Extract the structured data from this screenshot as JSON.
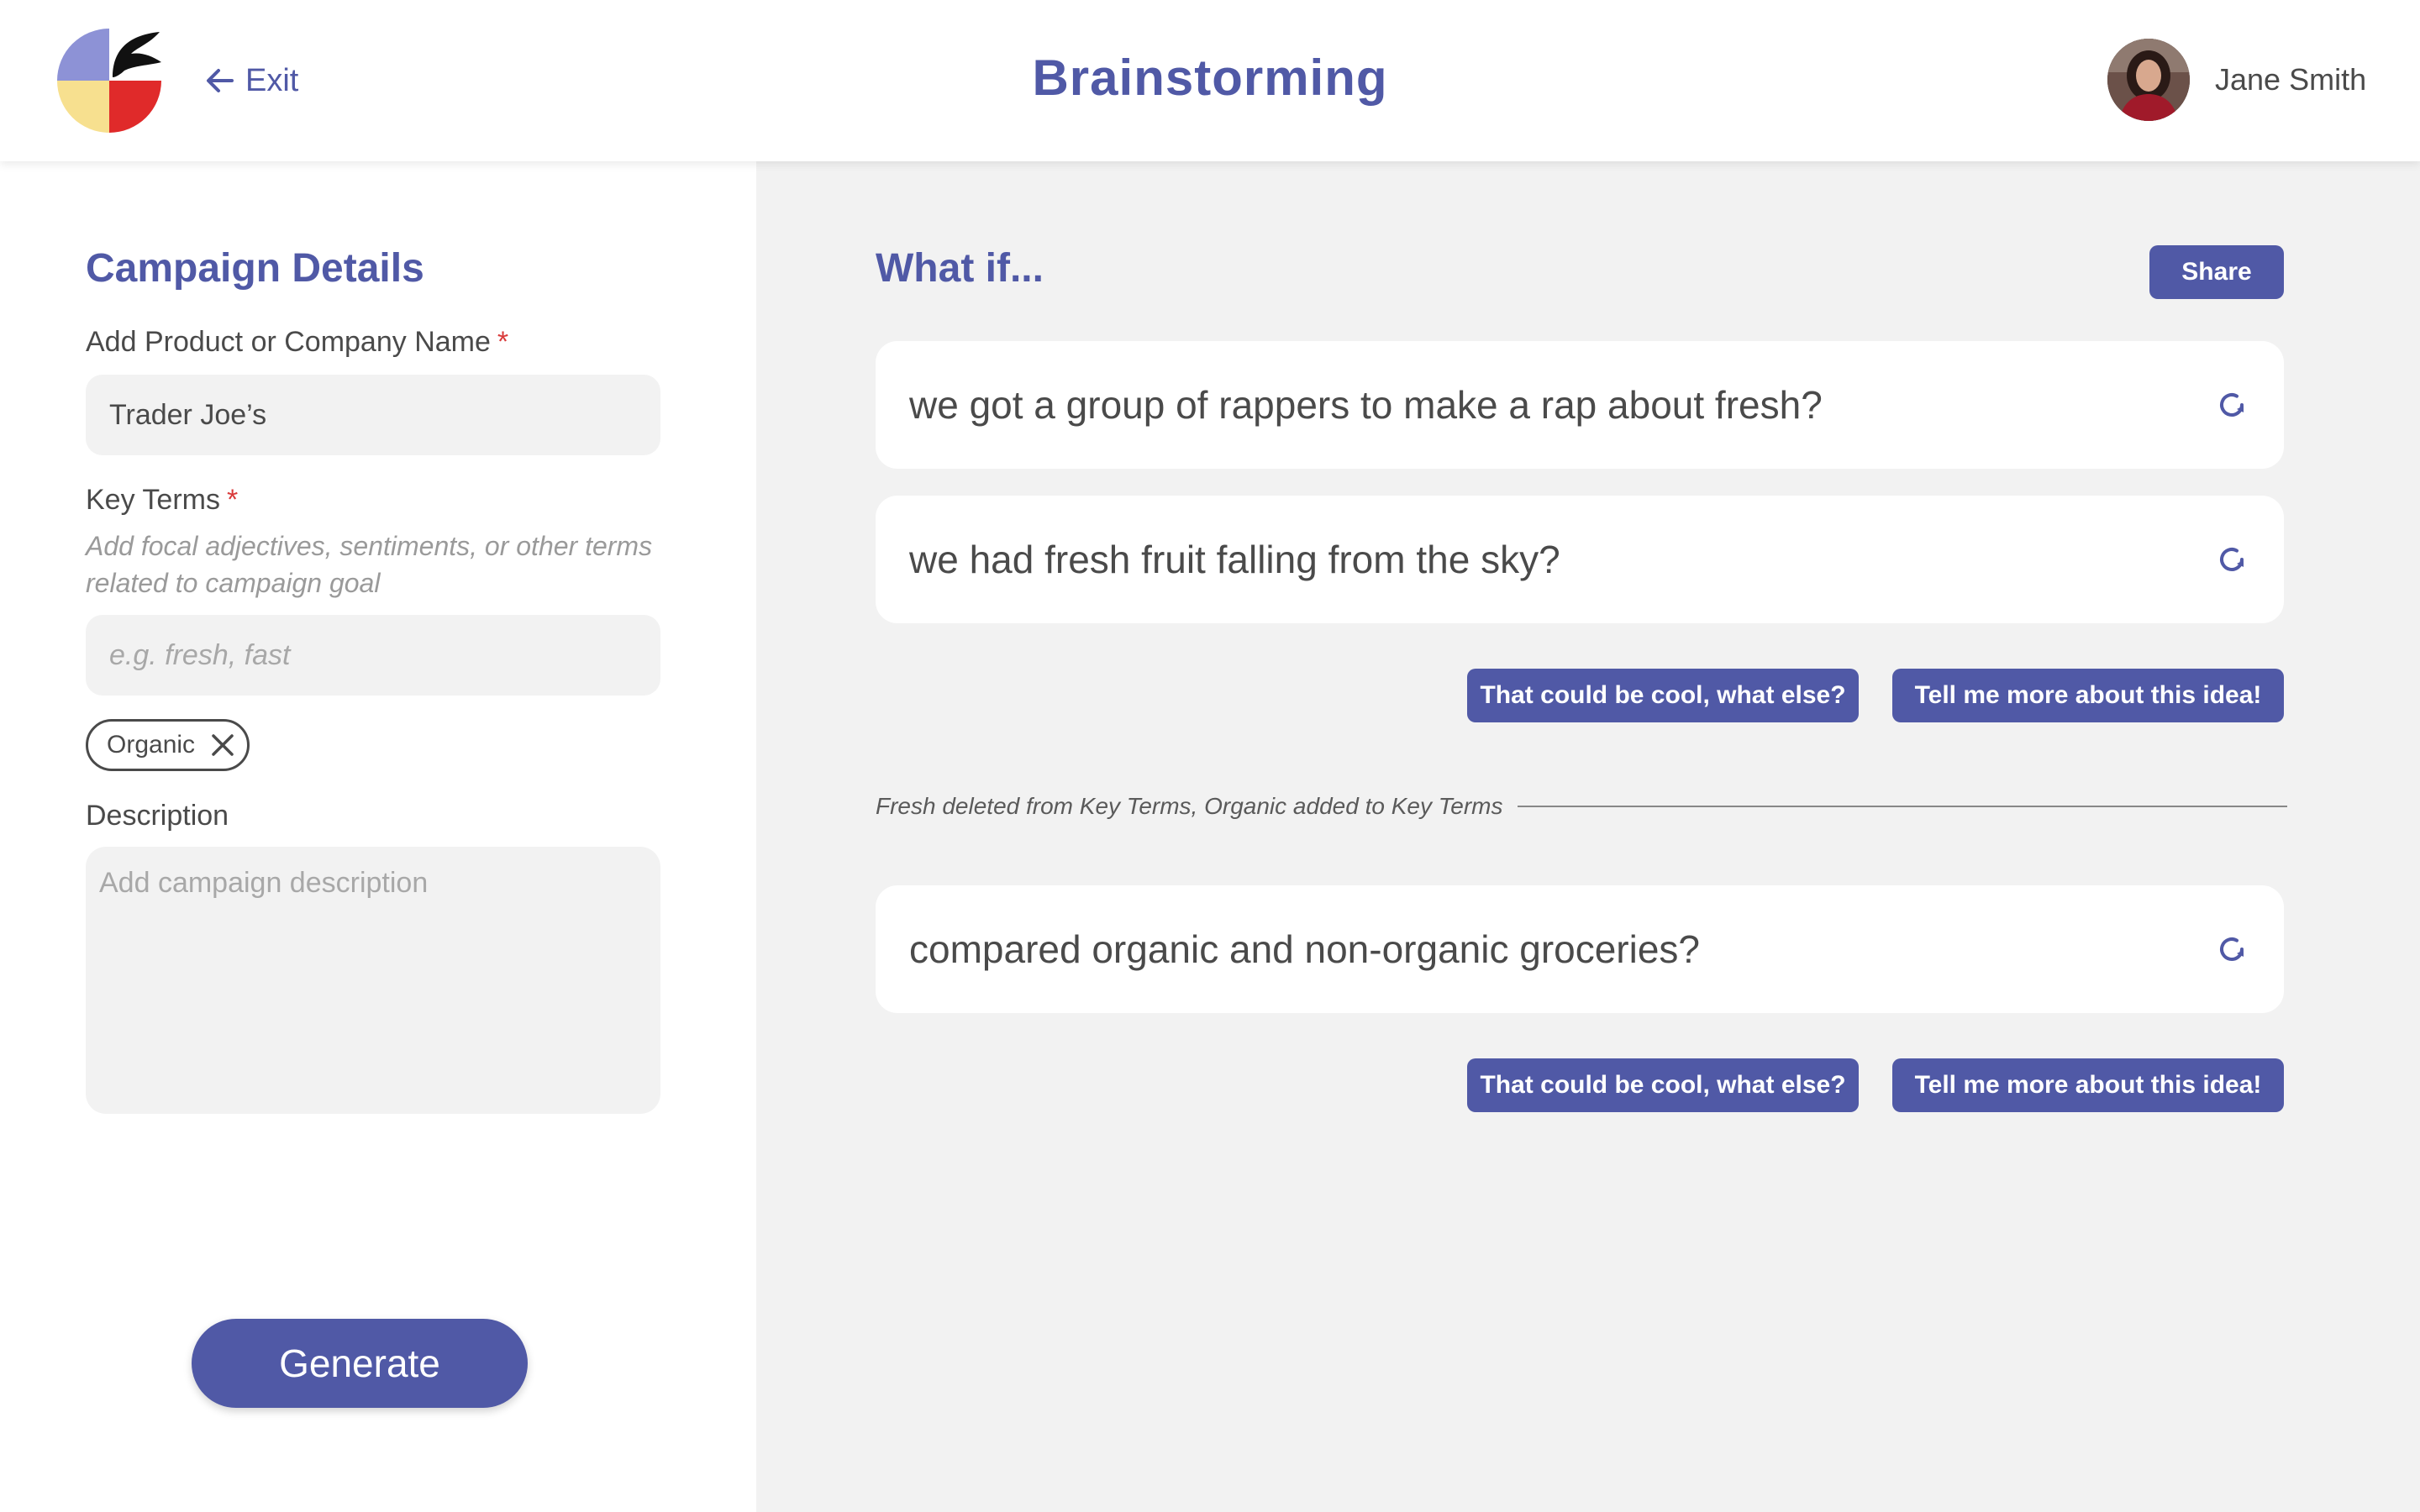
{
  "header": {
    "exit_label": "Exit",
    "title": "Brainstorming",
    "user_name": "Jane Smith"
  },
  "campaign": {
    "section_title": "Campaign Details",
    "product_label": "Add Product or Company Name",
    "product_value": "Trader Joe’s",
    "key_terms_label": "Key Terms",
    "required_mark": "*",
    "key_terms_hint": "Add focal adjectives, sentiments, or other terms related to campaign goal",
    "key_terms_placeholder": "e.g. fresh, fast",
    "chip_label": "Organic",
    "description_label": "Description",
    "description_placeholder": "Add campaign description",
    "generate_label": "Generate"
  },
  "ideas": {
    "heading": "What if...",
    "share_label": "Share",
    "cards": [
      "we got a group of rappers to make a rap about fresh?",
      "we had fresh fruit falling from the sky?",
      "compared organic and non-organic groceries?"
    ],
    "action_else": "That could be cool, what else?",
    "action_more": "Tell me more about this idea!",
    "change_note": "Fresh deleted from Key Terms, Organic added to Key Terms"
  },
  "colors": {
    "accent": "#5059a6",
    "required": "#d93a3a",
    "panel_bg": "#f2f2f2"
  },
  "icons": [
    "app-logo",
    "arrow-left-icon",
    "close-icon",
    "refresh-icon"
  ]
}
